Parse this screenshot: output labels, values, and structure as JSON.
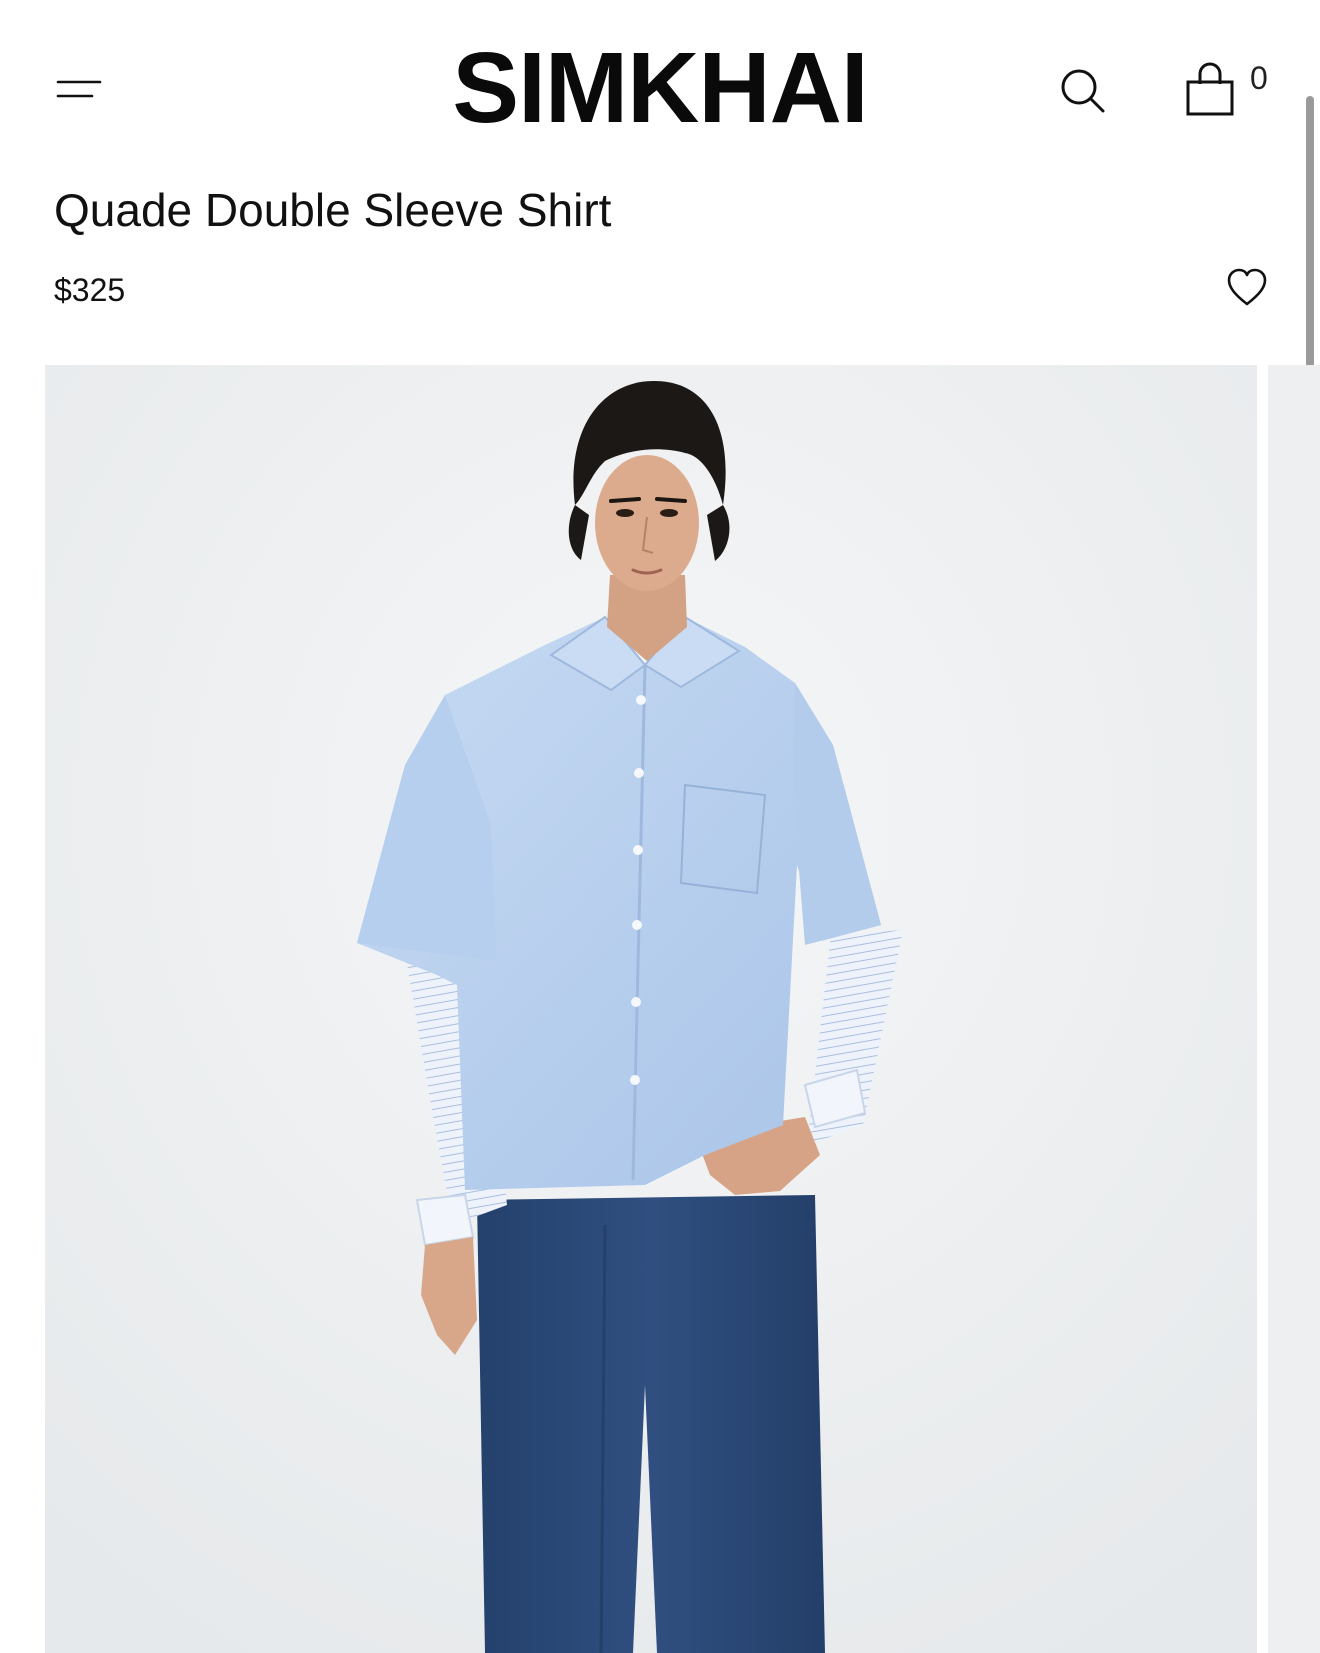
{
  "header": {
    "logo_text": "SIMKHAI",
    "menu_icon": "hamburger-menu-icon",
    "search_icon": "search-icon",
    "cart_icon": "shopping-bag-icon",
    "cart_count": "0"
  },
  "product": {
    "title": "Quade Double Sleeve Shirt",
    "price": "$325",
    "wishlist_icon": "heart-outline-icon"
  },
  "gallery": {
    "image_description_icon": "product-photo",
    "background_color": "#eef0f1"
  },
  "colors": {
    "text": "#111111",
    "shirt_blue": "#b9d1ef",
    "denim": "#2c4a78"
  }
}
